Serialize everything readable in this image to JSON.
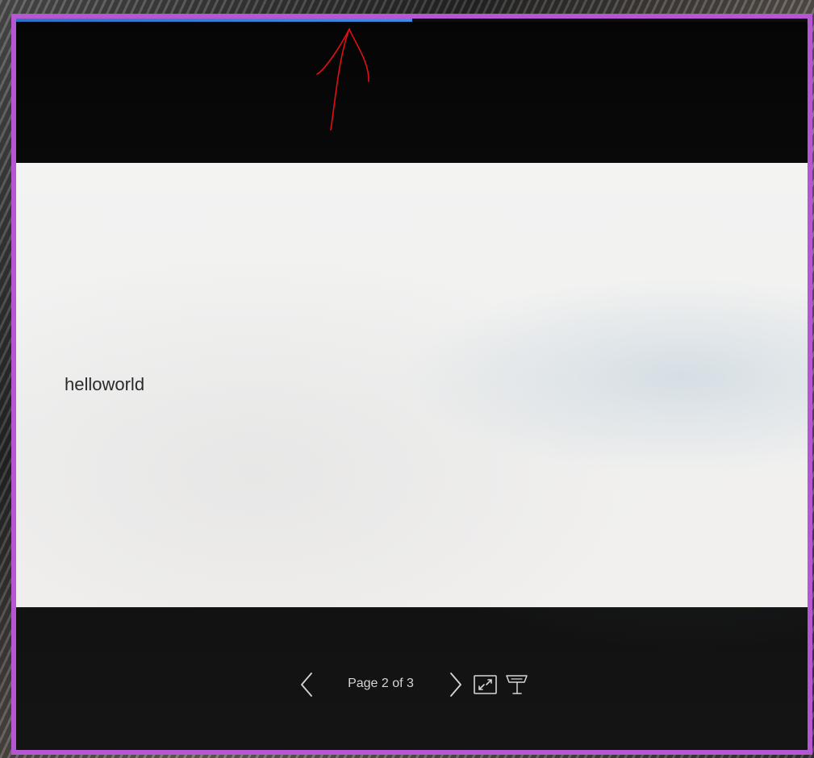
{
  "slide": {
    "text": "helloworld"
  },
  "progress": {
    "percent": 50
  },
  "controls": {
    "page_indicator": "Page 2 of 3",
    "current_page": 2,
    "total_pages": 3,
    "prev_icon": "chevron-left-icon",
    "next_icon": "chevron-right-icon",
    "fullscreen_icon": "expand-icon",
    "presenter_icon": "presenter-podium-icon"
  },
  "colors": {
    "frame_border": "#b556d2",
    "progress_fill": "#2a74c8",
    "annotation": "#e01010",
    "control_text": "#d6d6d6"
  }
}
